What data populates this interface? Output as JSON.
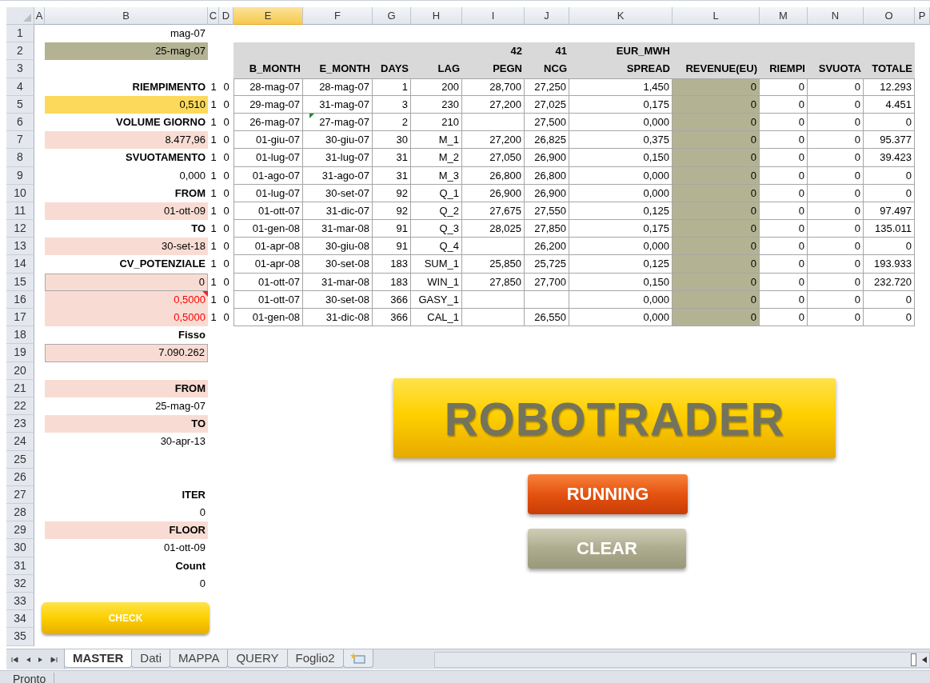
{
  "column_headers": [
    {
      "label": "A",
      "selected": false
    },
    {
      "label": "B",
      "selected": false
    },
    {
      "label": "C",
      "selected": false
    },
    {
      "label": "D",
      "selected": false
    },
    {
      "label": "E",
      "selected": true
    },
    {
      "label": "F",
      "selected": false
    },
    {
      "label": "G",
      "selected": false
    },
    {
      "label": "H",
      "selected": false
    },
    {
      "label": "I",
      "selected": false
    },
    {
      "label": "J",
      "selected": false
    },
    {
      "label": "K",
      "selected": false
    },
    {
      "label": "L",
      "selected": false
    },
    {
      "label": "M",
      "selected": false
    },
    {
      "label": "N",
      "selected": false
    },
    {
      "label": "O",
      "selected": false
    },
    {
      "label": "P",
      "selected": false
    }
  ],
  "rows": [
    {
      "number": "1",
      "b": {
        "text": "mag-07",
        "kind": "plain",
        "comment": false
      }
    },
    {
      "number": "2",
      "b": {
        "text": "25-mag-07",
        "kind": "olive",
        "comment": false
      }
    },
    {
      "number": "3"
    },
    {
      "number": "4",
      "b": {
        "text": "RIEMPIMENTO",
        "kind": "bold",
        "comment": false
      },
      "c": "1",
      "d": "0"
    },
    {
      "number": "5",
      "b": {
        "text": "0,510",
        "kind": "yellow",
        "comment": false
      },
      "c": "1",
      "d": "0"
    },
    {
      "number": "6",
      "b": {
        "text": "VOLUME GIORNO",
        "kind": "bold",
        "comment": false
      },
      "c": "1",
      "d": "0"
    },
    {
      "number": "7",
      "b": {
        "text": "8.477,96",
        "kind": "pink",
        "comment": false
      },
      "c": "1",
      "d": "0"
    },
    {
      "number": "8",
      "b": {
        "text": "SVUOTAMENTO",
        "kind": "bold",
        "comment": false
      },
      "c": "1",
      "d": "0"
    },
    {
      "number": "9",
      "b": {
        "text": "0,000",
        "kind": "plain",
        "comment": false
      },
      "c": "1",
      "d": "0"
    },
    {
      "number": "10",
      "b": {
        "text": "FROM",
        "kind": "bold",
        "comment": false
      },
      "c": "1",
      "d": "0"
    },
    {
      "number": "11",
      "b": {
        "text": "01-ott-09",
        "kind": "pink",
        "comment": false
      },
      "c": "1",
      "d": "0"
    },
    {
      "number": "12",
      "b": {
        "text": "TO",
        "kind": "bold",
        "comment": false
      },
      "c": "1",
      "d": "0"
    },
    {
      "number": "13",
      "b": {
        "text": "30-set-18",
        "kind": "pink",
        "comment": false
      },
      "c": "1",
      "d": "0"
    },
    {
      "number": "14",
      "b": {
        "text": "CV_POTENZIALE",
        "kind": "bold",
        "comment": false
      },
      "c": "1",
      "d": "0"
    },
    {
      "number": "15",
      "b": {
        "text": "0",
        "kind": "pink-boxed",
        "comment": false
      },
      "c": "1",
      "d": "0"
    },
    {
      "number": "16",
      "b": {
        "text": "0,5000",
        "kind": "pink-red",
        "comment": true
      },
      "c": "1",
      "d": "0"
    },
    {
      "number": "17",
      "b": {
        "text": "0,5000",
        "kind": "pink-red",
        "comment": false
      },
      "c": "1",
      "d": "0"
    },
    {
      "number": "18",
      "b": {
        "text": "Fisso",
        "kind": "bold",
        "comment": false
      }
    },
    {
      "number": "19",
      "b": {
        "text": "7.090.262",
        "kind": "pink-boxed",
        "comment": false
      }
    },
    {
      "number": "20"
    },
    {
      "number": "21",
      "b": {
        "text": "FROM",
        "kind": "pink-bold",
        "comment": false
      }
    },
    {
      "number": "22",
      "b": {
        "text": "25-mag-07",
        "kind": "plain",
        "comment": false
      }
    },
    {
      "number": "23",
      "b": {
        "text": "TO",
        "kind": "pink-bold",
        "comment": false
      }
    },
    {
      "number": "24",
      "b": {
        "text": "30-apr-13",
        "kind": "plain",
        "comment": false
      }
    },
    {
      "number": "25"
    },
    {
      "number": "26"
    },
    {
      "number": "27",
      "b": {
        "text": "ITER",
        "kind": "bold",
        "comment": false
      }
    },
    {
      "number": "28",
      "b": {
        "text": "0",
        "kind": "plain",
        "comment": false
      }
    },
    {
      "number": "29",
      "b": {
        "text": "FLOOR",
        "kind": "pink-bold",
        "comment": false
      }
    },
    {
      "number": "30",
      "b": {
        "text": "01-ott-09",
        "kind": "plain",
        "comment": false
      }
    },
    {
      "number": "31",
      "b": {
        "text": "Count",
        "kind": "bold",
        "comment": false
      }
    },
    {
      "number": "32",
      "b": {
        "text": "0",
        "kind": "plain",
        "comment": false
      }
    },
    {
      "number": "33"
    },
    {
      "number": "34"
    },
    {
      "number": "35"
    }
  ],
  "table": {
    "header": [
      {
        "label": "B_MONTH"
      },
      {
        "label": "E_MONTH"
      },
      {
        "label": "DAYS"
      },
      {
        "label": "LAG"
      },
      {
        "label": "PEGN",
        "above": "42"
      },
      {
        "label": "NCG",
        "above": "41"
      },
      {
        "label": "SPREAD",
        "above": "EUR_MWH"
      },
      {
        "label": "REVENUE(EU)"
      },
      {
        "label": "RIEMPI"
      },
      {
        "label": "SVUOTA"
      },
      {
        "label": "TOTALE"
      }
    ],
    "rows": [
      {
        "cells": [
          "28-mag-07",
          "28-mag-07",
          "1",
          "200",
          "28,700",
          "27,250",
          "1,450",
          "0",
          "0",
          "0",
          "12.293"
        ],
        "flagged": false
      },
      {
        "cells": [
          "29-mag-07",
          "31-mag-07",
          "3",
          "230",
          "27,200",
          "27,025",
          "0,175",
          "0",
          "0",
          "0",
          "4.451"
        ],
        "flagged": false
      },
      {
        "cells": [
          "26-mag-07",
          "27-mag-07",
          "2",
          "210",
          null,
          "27,500",
          "0,000",
          "0",
          "0",
          "0",
          "0"
        ],
        "flagged": true
      },
      {
        "cells": [
          "01-giu-07",
          "30-giu-07",
          "30",
          "M_1",
          "27,200",
          "26,825",
          "0,375",
          "0",
          "0",
          "0",
          "95.377"
        ],
        "flagged": false
      },
      {
        "cells": [
          "01-lug-07",
          "31-lug-07",
          "31",
          "M_2",
          "27,050",
          "26,900",
          "0,150",
          "0",
          "0",
          "0",
          "39.423"
        ],
        "flagged": false
      },
      {
        "cells": [
          "01-ago-07",
          "31-ago-07",
          "31",
          "M_3",
          "26,800",
          "26,800",
          "0,000",
          "0",
          "0",
          "0",
          "0"
        ],
        "flagged": false
      },
      {
        "cells": [
          "01-lug-07",
          "30-set-07",
          "92",
          "Q_1",
          "26,900",
          "26,900",
          "0,000",
          "0",
          "0",
          "0",
          "0"
        ],
        "flagged": false
      },
      {
        "cells": [
          "01-ott-07",
          "31-dic-07",
          "92",
          "Q_2",
          "27,675",
          "27,550",
          "0,125",
          "0",
          "0",
          "0",
          "97.497"
        ],
        "flagged": false
      },
      {
        "cells": [
          "01-gen-08",
          "31-mar-08",
          "91",
          "Q_3",
          "28,025",
          "27,850",
          "0,175",
          "0",
          "0",
          "0",
          "135.011"
        ],
        "flagged": false
      },
      {
        "cells": [
          "01-apr-08",
          "30-giu-08",
          "91",
          "Q_4",
          null,
          "26,200",
          "0,000",
          "0",
          "0",
          "0",
          "0"
        ],
        "flagged": false
      },
      {
        "cells": [
          "01-apr-08",
          "30-set-08",
          "183",
          "SUM_1",
          "25,850",
          "25,725",
          "0,125",
          "0",
          "0",
          "0",
          "193.933"
        ],
        "flagged": false
      },
      {
        "cells": [
          "01-ott-07",
          "31-mar-08",
          "183",
          "WIN_1",
          "27,850",
          "27,700",
          "0,150",
          "0",
          "0",
          "0",
          "232.720"
        ],
        "flagged": false
      },
      {
        "cells": [
          "01-ott-07",
          "30-set-08",
          "366",
          "GASY_1",
          null,
          null,
          "0,000",
          "0",
          "0",
          "0",
          "0"
        ],
        "flagged": false
      },
      {
        "cells": [
          "01-gen-08",
          "31-dic-08",
          "366",
          "CAL_1",
          null,
          "26,550",
          "0,000",
          "0",
          "0",
          "0",
          "0"
        ],
        "flagged": false
      }
    ]
  },
  "shapes": [
    {
      "kind": "banner",
      "label": "ROBOTRADER"
    },
    {
      "kind": "running",
      "label": "RUNNING"
    },
    {
      "kind": "clear",
      "label": "CLEAR"
    },
    {
      "kind": "check",
      "label": "CHECK"
    }
  ],
  "sheet_tabs": [
    {
      "label": "MASTER",
      "selected": true
    },
    {
      "label": "Dati",
      "selected": false
    },
    {
      "label": "MAPPA",
      "selected": false
    },
    {
      "label": "QUERY",
      "selected": false
    },
    {
      "label": "Foglio2",
      "selected": false
    }
  ],
  "status_bar": {
    "text": "Pronto"
  }
}
